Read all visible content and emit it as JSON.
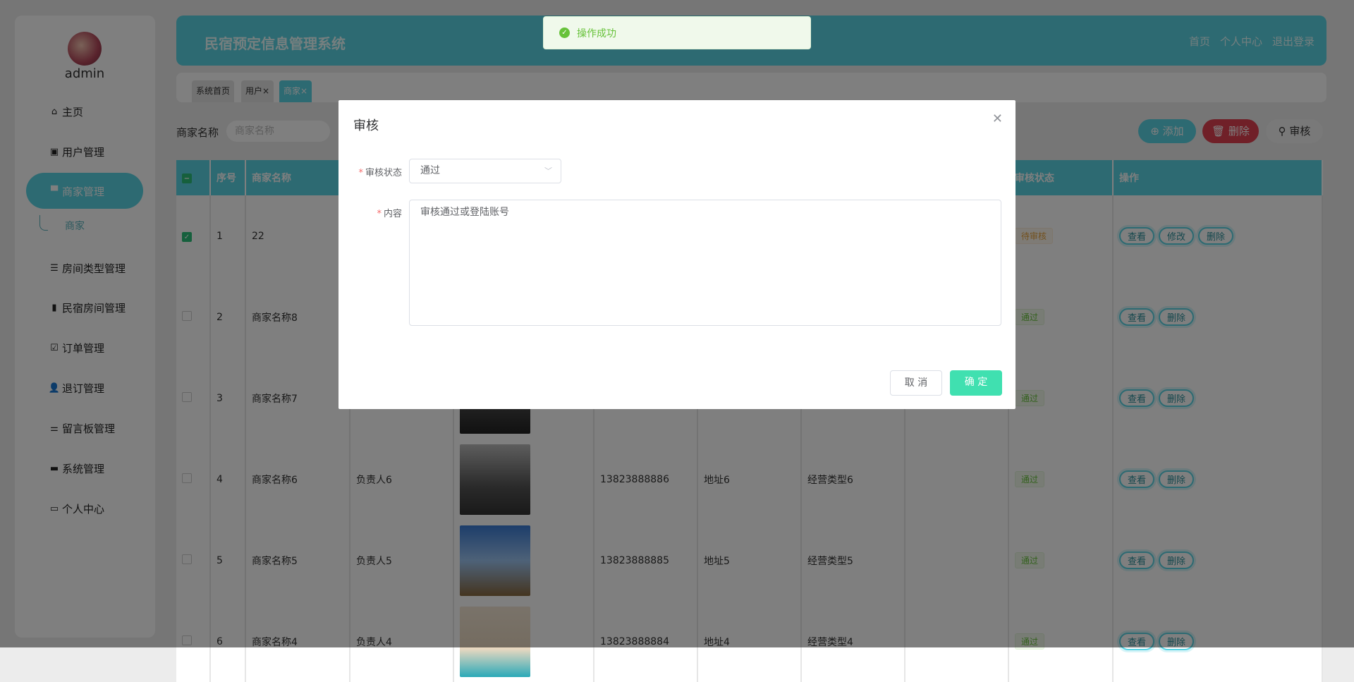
{
  "sidebar": {
    "username": "admin",
    "items": [
      {
        "label": "主页",
        "icon": "home-icon"
      },
      {
        "label": "用户管理",
        "icon": "clipboard-x-icon"
      },
      {
        "label": "商家管理",
        "icon": "monitor-icon"
      },
      {
        "label": "房间类型管理",
        "icon": "list-icon"
      },
      {
        "label": "民宿房间管理",
        "icon": "books-icon"
      },
      {
        "label": "订单管理",
        "icon": "clipboard-check-icon"
      },
      {
        "label": "退订管理",
        "icon": "user-icon"
      },
      {
        "label": "留言板管理",
        "icon": "sliders-icon"
      },
      {
        "label": "系统管理",
        "icon": "wallet-icon"
      },
      {
        "label": "个人中心",
        "icon": "card-icon"
      }
    ],
    "sub_item": "商家"
  },
  "header": {
    "title": "民宿预定信息管理系统",
    "links": [
      "首页",
      "个人中心",
      "退出登录"
    ]
  },
  "tabs": [
    "系统首页",
    "用户×",
    "商家×"
  ],
  "search": {
    "label": "商家名称",
    "placeholder": "商家名称"
  },
  "toolbar": {
    "add": "添加",
    "delete": "删除",
    "audit": "审核"
  },
  "table": {
    "headers": [
      "序号",
      "商家名称",
      "",
      "",
      "",
      "",
      "",
      "",
      "审核状态",
      "操作"
    ],
    "rows": [
      {
        "no": "1",
        "name": "22",
        "person": "",
        "phone": "",
        "addr": "",
        "type": "",
        "status": "待审核",
        "checked": true,
        "ops": [
          "查看",
          "修改",
          "删除"
        ]
      },
      {
        "no": "2",
        "name": "商家名称8",
        "person": "",
        "phone": "",
        "addr": "",
        "type": "",
        "status": "通过",
        "checked": false,
        "ops": [
          "查看",
          "删除"
        ]
      },
      {
        "no": "3",
        "name": "商家名称7",
        "person": "",
        "phone": "",
        "addr": "",
        "type": "",
        "status": "通过",
        "checked": false,
        "ops": [
          "查看",
          "删除"
        ]
      },
      {
        "no": "4",
        "name": "商家名称6",
        "person": "负责人6",
        "phone": "13823888886",
        "addr": "地址6",
        "type": "经营类型6",
        "status": "通过",
        "checked": false,
        "ops": [
          "查看",
          "删除"
        ]
      },
      {
        "no": "5",
        "name": "商家名称5",
        "person": "负责人5",
        "phone": "13823888885",
        "addr": "地址5",
        "type": "经营类型5",
        "status": "通过",
        "checked": false,
        "ops": [
          "查看",
          "删除"
        ]
      },
      {
        "no": "6",
        "name": "商家名称4",
        "person": "负责人4",
        "phone": "13823888884",
        "addr": "地址4",
        "type": "经营类型4",
        "status": "通过",
        "checked": false,
        "ops": [
          "查看",
          "删除"
        ]
      }
    ]
  },
  "modal": {
    "title": "审核",
    "status_label": "审核状态",
    "status_value": "通过",
    "content_label": "内容",
    "content_value": "审核通过或登陆账号",
    "cancel": "取 消",
    "confirm": "确 定"
  },
  "toast": {
    "message": "操作成功"
  },
  "colors": {
    "primary": "#5ad4e4",
    "danger": "#e04050",
    "success": "#67c23a",
    "confirm": "#40e0b0"
  }
}
